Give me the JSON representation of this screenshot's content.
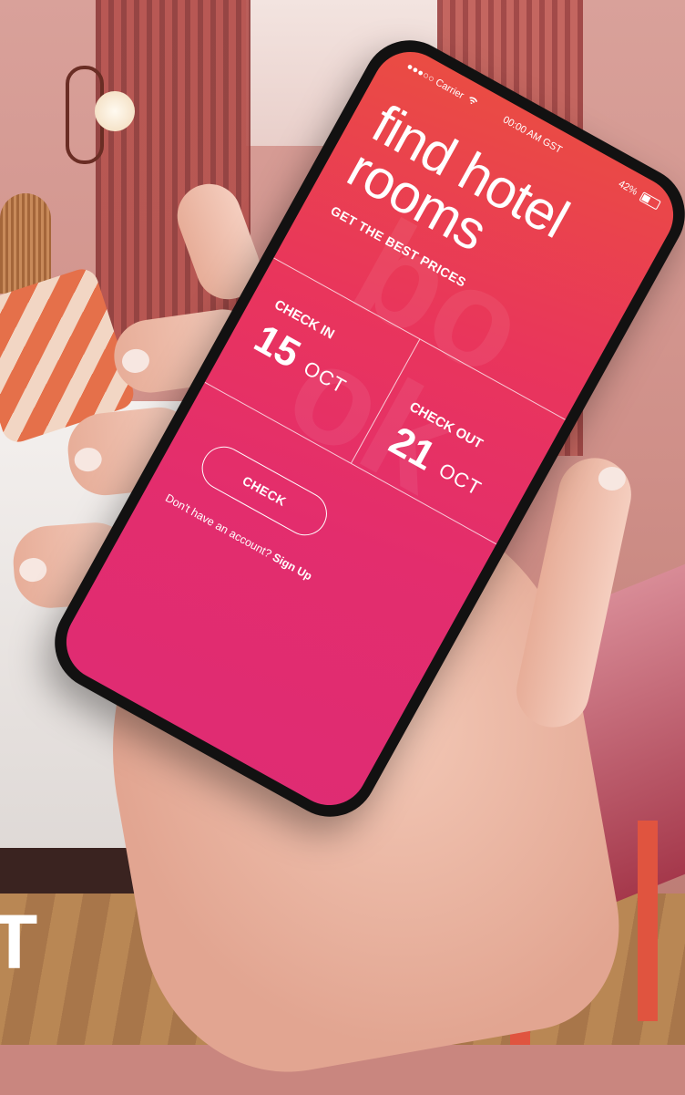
{
  "status_bar": {
    "carrier": "Carrier",
    "time": "00:00 AM GST",
    "battery": "42%",
    "battery_level": 0.42
  },
  "hero": {
    "title": "find hotel rooms",
    "subtitle": "GET THE BEST PRICES"
  },
  "check_in": {
    "label": "CHECK IN",
    "day": "15",
    "month": "OCT"
  },
  "check_out": {
    "label": "CHECK OUT",
    "day": "21",
    "month": "OCT"
  },
  "actions": {
    "check_label": "CHECK",
    "signup_prompt": "Don't have an account?",
    "signup_link": "Sign Up"
  },
  "page_edge": {
    "letter": "T"
  },
  "colors": {
    "screen_top": "#ea4d42",
    "screen_bottom": "#df2c73",
    "phone_frame": "#121111"
  },
  "icons": [
    "signal-dots-icon",
    "wifi-icon",
    "battery-icon"
  ]
}
